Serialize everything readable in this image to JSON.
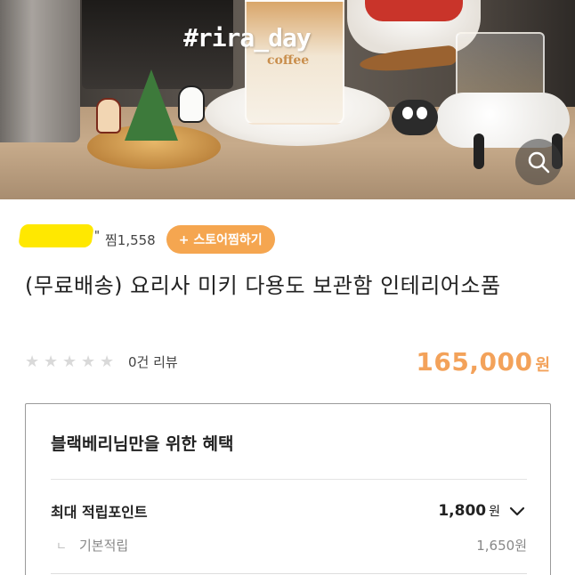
{
  "hero": {
    "hashtag": "#rira_day",
    "glass_text": "coffee",
    "search_icon": "search-icon"
  },
  "store": {
    "name_censored": true,
    "quote_mark": "\"",
    "like_count": "찜1,558",
    "follow_label": "+ 스토어찜하기"
  },
  "product": {
    "title": "(무료배송) 요리사 미키 다용도 보관함 인테리어소품",
    "rating_stars": 0,
    "review_count": "0건 리뷰",
    "price": "165,000",
    "price_unit": "원"
  },
  "benefit": {
    "title": "블랙베리님만을 위한 혜택",
    "max_point_label": "최대 적립포인트",
    "max_point_value": "1,800",
    "max_point_unit": "원",
    "basic_label": "기본적립",
    "basic_mark": "ㄴ",
    "basic_value": "1,650원"
  },
  "colors": {
    "accent": "#f5a650",
    "price": "#f3a25a",
    "border": "#9a9a9a"
  }
}
